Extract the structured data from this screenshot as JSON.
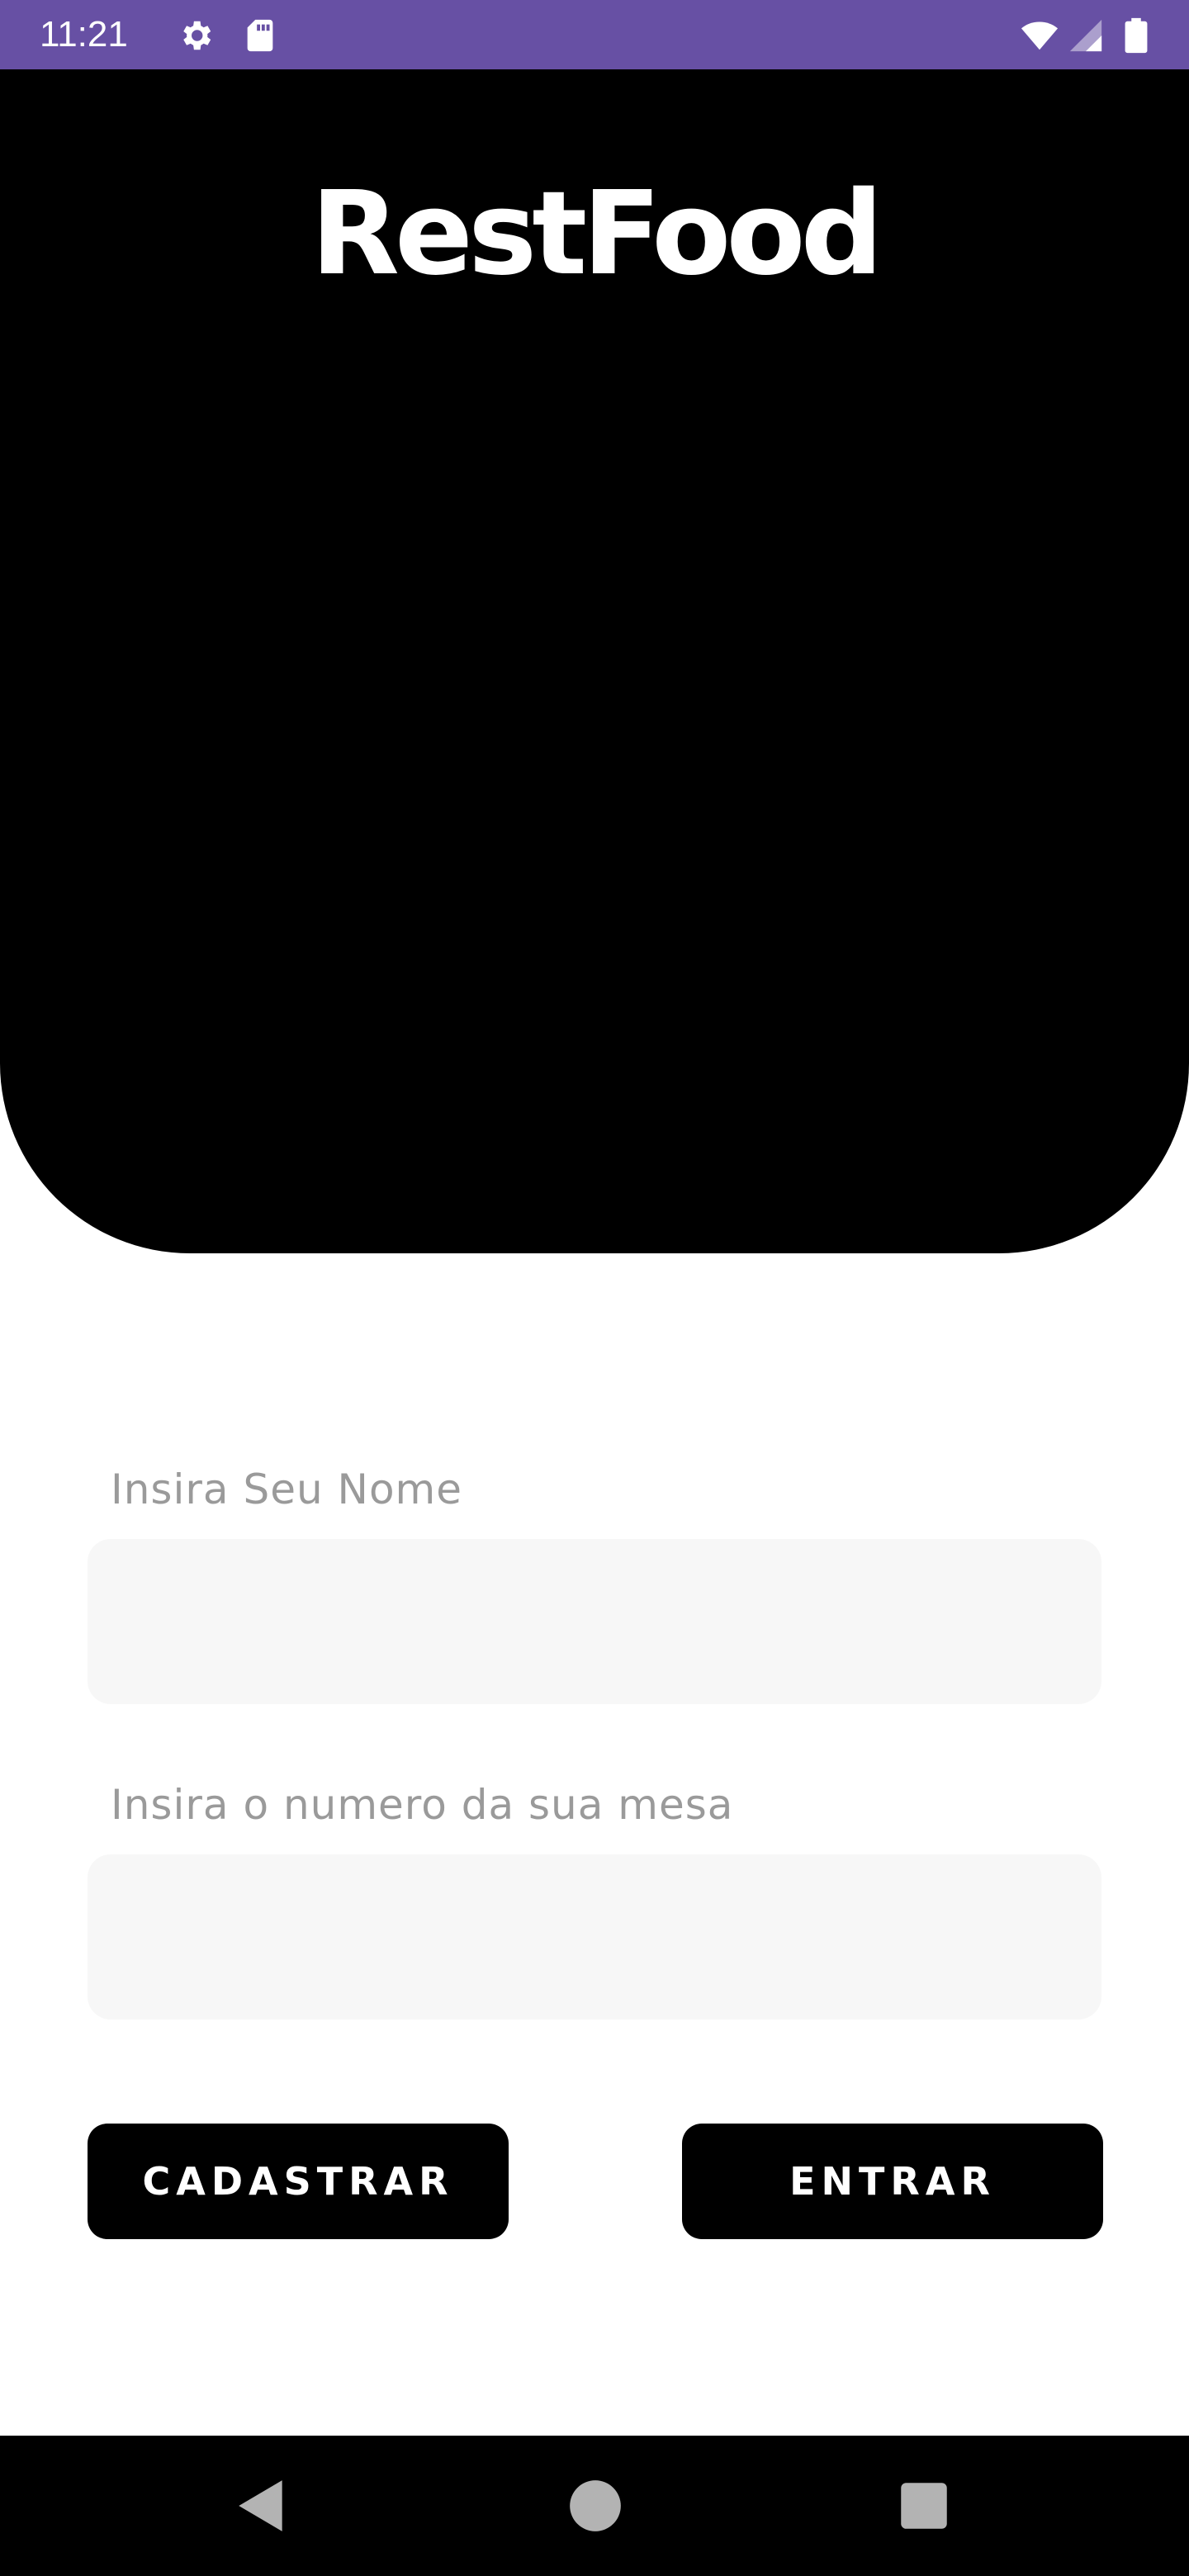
{
  "status_bar": {
    "time": "11:21",
    "left_icons": [
      "gear-icon",
      "sd-card-icon"
    ],
    "right_icons": [
      "wifi-icon",
      "signal-icon",
      "battery-icon"
    ],
    "background_color": "#6750a4"
  },
  "header": {
    "brand": "RestFood",
    "background_color": "#000000"
  },
  "form": {
    "name_label": "Insira Seu Nome",
    "name_value": "",
    "table_label": "Insira o numero da sua mesa",
    "table_value": ""
  },
  "actions": {
    "register_label": "CADASTRAR",
    "enter_label": "ENTRAR"
  },
  "nav_bar": {
    "buttons": [
      "back-icon",
      "home-icon",
      "recents-icon"
    ]
  }
}
